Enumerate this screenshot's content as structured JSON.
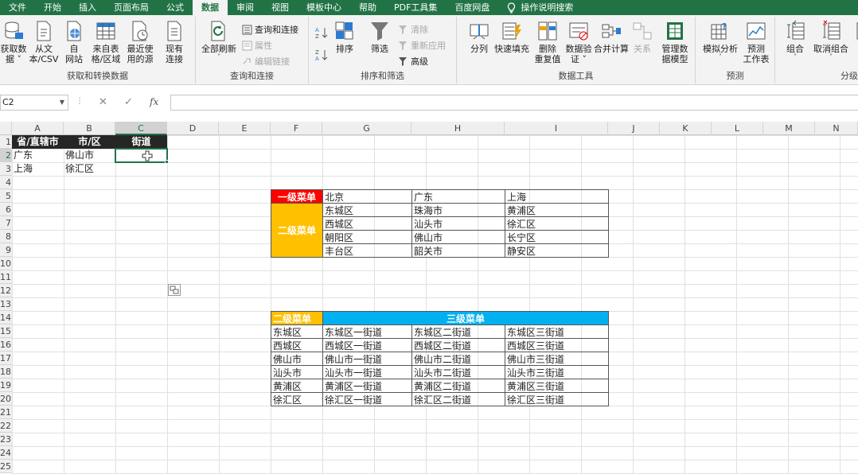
{
  "tabs": [
    "文件",
    "开始",
    "插入",
    "页面布局",
    "公式",
    "数据",
    "审阅",
    "视图",
    "模板中心",
    "帮助",
    "PDF工具集",
    "百度网盘"
  ],
  "tell_me": "操作说明搜索",
  "groups": {
    "get": {
      "label": "获取和转换数据",
      "buttons": [
        {
          "line1": "获取数",
          "line2": "据 ˅"
        },
        {
          "line1": "从文",
          "line2": "本/CSV"
        },
        {
          "line1": "自",
          "line2": "网站"
        },
        {
          "line1": "来自表",
          "line2": "格/区域"
        },
        {
          "line1": "最近使",
          "line2": "用的源"
        },
        {
          "line1": "现有",
          "line2": "连接"
        }
      ]
    },
    "query": {
      "label": "查询和连接",
      "refresh_line1": "全部刷新",
      "refresh_line2": "˅",
      "items": [
        "查询和连接",
        "属性",
        "编辑链接"
      ]
    },
    "sort": {
      "label": "排序和筛选",
      "sort_label": "排序",
      "filter_label": "筛选",
      "items": [
        "清除",
        "重新应用",
        "高级"
      ]
    },
    "tools": {
      "label": "数据工具",
      "buttons": [
        {
          "line1": "分列",
          "line2": ""
        },
        {
          "line1": "快速填充",
          "line2": ""
        },
        {
          "line1": "删除",
          "line2": "重复值"
        },
        {
          "line1": "数据验",
          "line2": "证 ˅"
        },
        {
          "line1": "合并计算",
          "line2": ""
        },
        {
          "line1": "关系",
          "line2": ""
        },
        {
          "line1": "管理数",
          "line2": "据模型"
        }
      ]
    },
    "forecast": {
      "label": "预测",
      "buttons": [
        {
          "line1": "模拟分析",
          "line2": "˅"
        },
        {
          "line1": "预测",
          "line2": "工作表"
        }
      ]
    },
    "outline": {
      "label": "分级",
      "buttons": [
        {
          "line1": "组合",
          "line2": "˅"
        },
        {
          "line1": "取消组合",
          "line2": "˅"
        },
        {
          "line1": "分",
          "line2": ""
        }
      ]
    }
  },
  "formula_bar": {
    "name_box": "C2",
    "formula": ""
  },
  "columns": [
    "A",
    "B",
    "C",
    "D",
    "E",
    "F",
    "G",
    "H",
    "I",
    "J",
    "K",
    "L",
    "M",
    "N"
  ],
  "rows": [
    "1",
    "2",
    "3",
    "4",
    "5",
    "6",
    "7",
    "8",
    "9",
    "10",
    "11",
    "12",
    "13",
    "14",
    "15",
    "16",
    "17",
    "18",
    "19",
    "20",
    "21",
    "22",
    "23",
    "24",
    "25"
  ],
  "header_row": [
    "省/直辖市",
    "市/区",
    "街道"
  ],
  "input_rows": [
    [
      "广东",
      "佛山市",
      ""
    ],
    [
      "上海",
      "徐汇区",
      ""
    ]
  ],
  "menu1": {
    "label_l1": "一级菜单",
    "label_l2": "二级菜单",
    "provinces": [
      "北京",
      "广东",
      "上海"
    ],
    "cities": [
      [
        "东城区",
        "珠海市",
        "黄浦区"
      ],
      [
        "西城区",
        "汕头市",
        "徐汇区"
      ],
      [
        "朝阳区",
        "佛山市",
        "长宁区"
      ],
      [
        "丰台区",
        "韶关市",
        "静安区"
      ]
    ]
  },
  "menu2": {
    "label_l2": "二级菜单",
    "label_l3": "三级菜单",
    "rows": [
      [
        "东城区",
        "东城区一街道",
        "东城区二街道",
        "东城区三街道"
      ],
      [
        "西城区",
        "西城区一街道",
        "西城区二街道",
        "西城区三街道"
      ],
      [
        "佛山市",
        "佛山市一街道",
        "佛山市二街道",
        "佛山市三街道"
      ],
      [
        "汕头市",
        "汕头市一街道",
        "汕头市二街道",
        "汕头市三街道"
      ],
      [
        "黄浦区",
        "黄浦区一街道",
        "黄浦区二街道",
        "黄浦区三街道"
      ],
      [
        "徐汇区",
        "徐汇区一街道",
        "徐汇区二街道",
        "徐汇区三街道"
      ]
    ]
  },
  "colors": {
    "excel_green": "#217346",
    "red": "#ff0000",
    "orange": "#ffc000",
    "blue": "#00b0f0",
    "dark": "#262626"
  }
}
